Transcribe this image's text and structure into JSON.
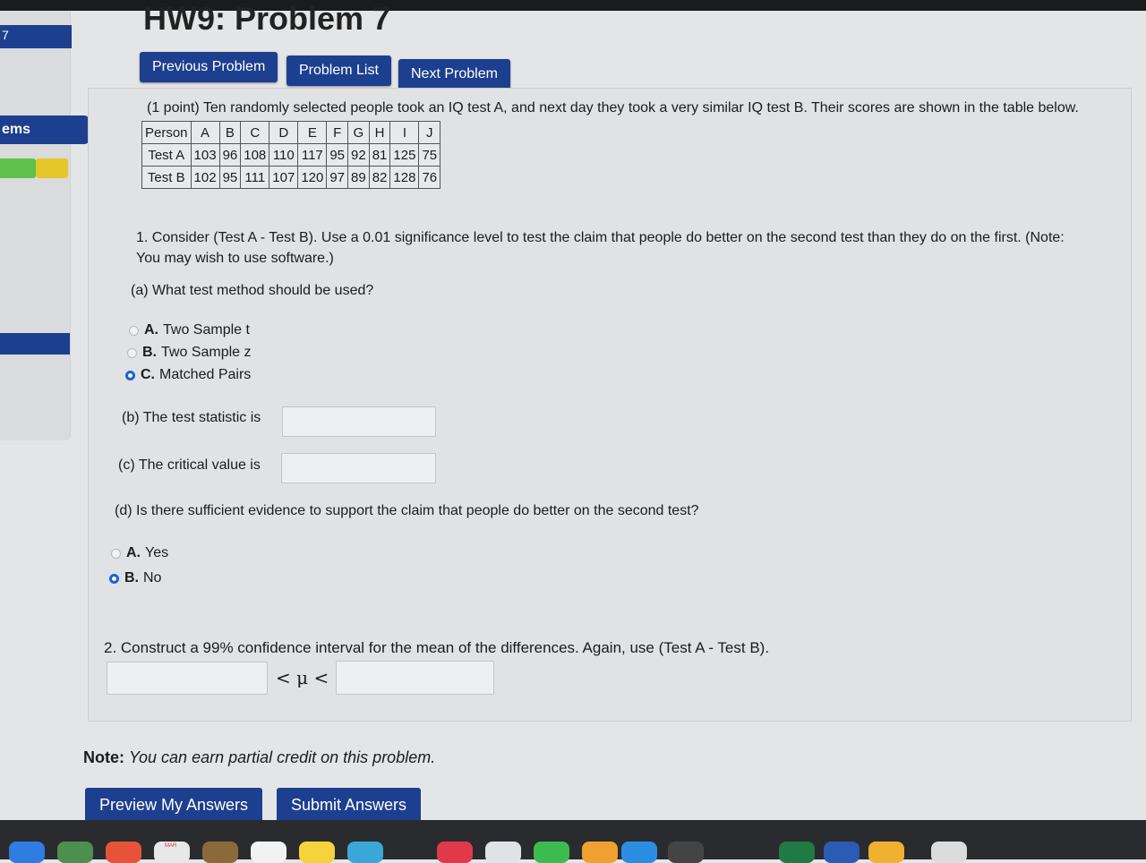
{
  "sidebar": {
    "number": "7",
    "items_label": "ems"
  },
  "header": {
    "title": "HW9: Problem 7"
  },
  "nav": {
    "previous": "Previous Problem",
    "list": "Problem List",
    "next": "Next Problem"
  },
  "problem": {
    "intro": "(1 point) Ten randomly selected people took an IQ test A, and next day they took a very similar IQ test B. Their scores are shown in the table below.",
    "table": {
      "header": [
        "Person",
        "A",
        "B",
        "C",
        "D",
        "E",
        "F",
        "G",
        "H",
        "I",
        "J"
      ],
      "rows": [
        [
          "Test A",
          "103",
          "96",
          "108",
          "110",
          "117",
          "95",
          "92",
          "81",
          "125",
          "75"
        ],
        [
          "Test B",
          "102",
          "95",
          "111",
          "107",
          "120",
          "97",
          "89",
          "82",
          "128",
          "76"
        ]
      ]
    },
    "q1": "1. Consider (Test A - Test B). Use a 0.01 significance level to test the claim that people do better on the second test than they do on the first. (Note: You may wish to use software.)",
    "qa": "(a) What test method should be used?",
    "qa_options": [
      {
        "key": "A.",
        "text": "Two Sample t"
      },
      {
        "key": "B.",
        "text": "Two Sample z"
      },
      {
        "key": "C.",
        "text": "Matched Pairs"
      }
    ],
    "qa_selected": "C.",
    "qb": "(b) The test statistic is",
    "qb_value": "",
    "qc": "(c) The critical value is",
    "qc_value": "",
    "qd": "(d) Is there sufficient evidence to support the claim that people do better on the second test?",
    "qd_options": [
      {
        "key": "A.",
        "text": "Yes"
      },
      {
        "key": "B.",
        "text": "No"
      }
    ],
    "qd_selected": "B.",
    "q2": "2. Construct a 99% confidence interval for the mean of the differences. Again, use (Test A - Test B).",
    "ci_symbol": "< μ <",
    "ci_lower": "",
    "ci_upper": ""
  },
  "note": {
    "bold": "Note:",
    "text": "You can earn partial credit on this problem."
  },
  "actions": {
    "preview": "Preview My Answers",
    "submit": "Submit Answers"
  },
  "dock": {
    "calendar_label": "MAR"
  }
}
